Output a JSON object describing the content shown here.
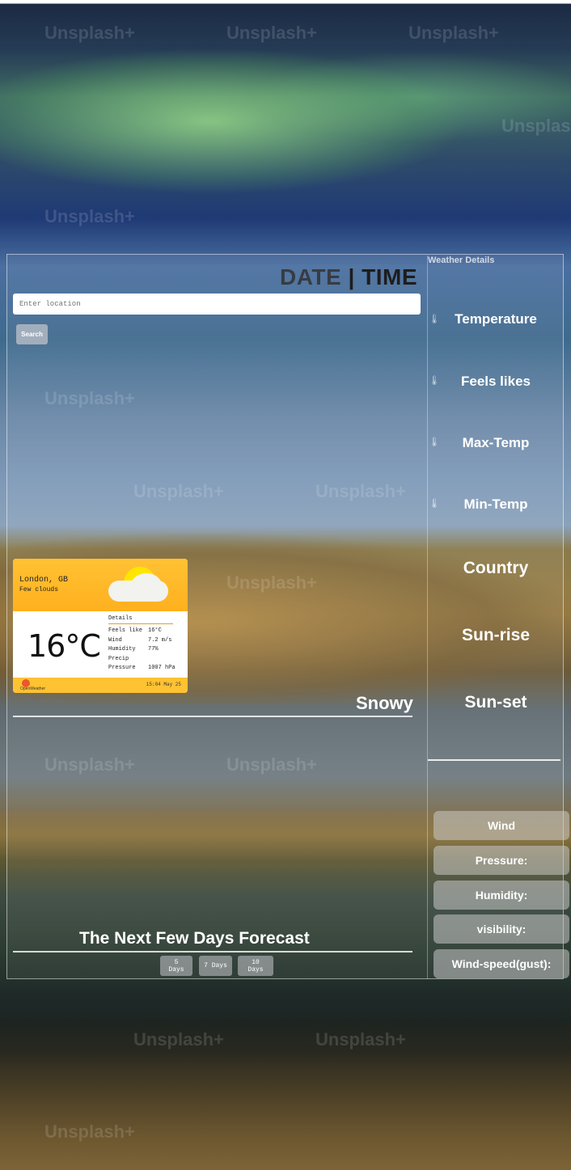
{
  "header": {
    "date_label": "DATE",
    "separator": "|",
    "time_label": "TIME"
  },
  "search": {
    "placeholder": "Enter location",
    "button_label": "Search"
  },
  "widget": {
    "city": "London, GB",
    "condition": "Few clouds",
    "temperature": "16°C",
    "details_title": "Details",
    "rows": [
      {
        "label": "Feels like",
        "value": "16°C"
      },
      {
        "label": "Wind",
        "value": "7.2 m/s"
      },
      {
        "label": "Humidity",
        "value": "77%"
      },
      {
        "label": "Precip",
        "value": ""
      },
      {
        "label": "Pressure",
        "value": "1007 hPa"
      }
    ],
    "brand": "OpenWeather",
    "timestamp": "15:04 May 25"
  },
  "main": {
    "condition": "Snowy",
    "forecast_title": "The Next Few Days Forecast",
    "forecast_buttons": [
      "5 Days",
      "7 Days",
      "10 Days"
    ]
  },
  "weather_details": {
    "title": "Weather Details",
    "items": [
      "Temperature",
      "Feels likes",
      "Max-Temp",
      "Min-Temp",
      "Country",
      "Sun-rise",
      "Sun-set"
    ]
  },
  "metrics": [
    "Wind",
    "Pressure:",
    "Humidity:",
    "visibility:",
    "Wind-speed(gust):"
  ],
  "background": {
    "watermark": "Unsplash+"
  }
}
